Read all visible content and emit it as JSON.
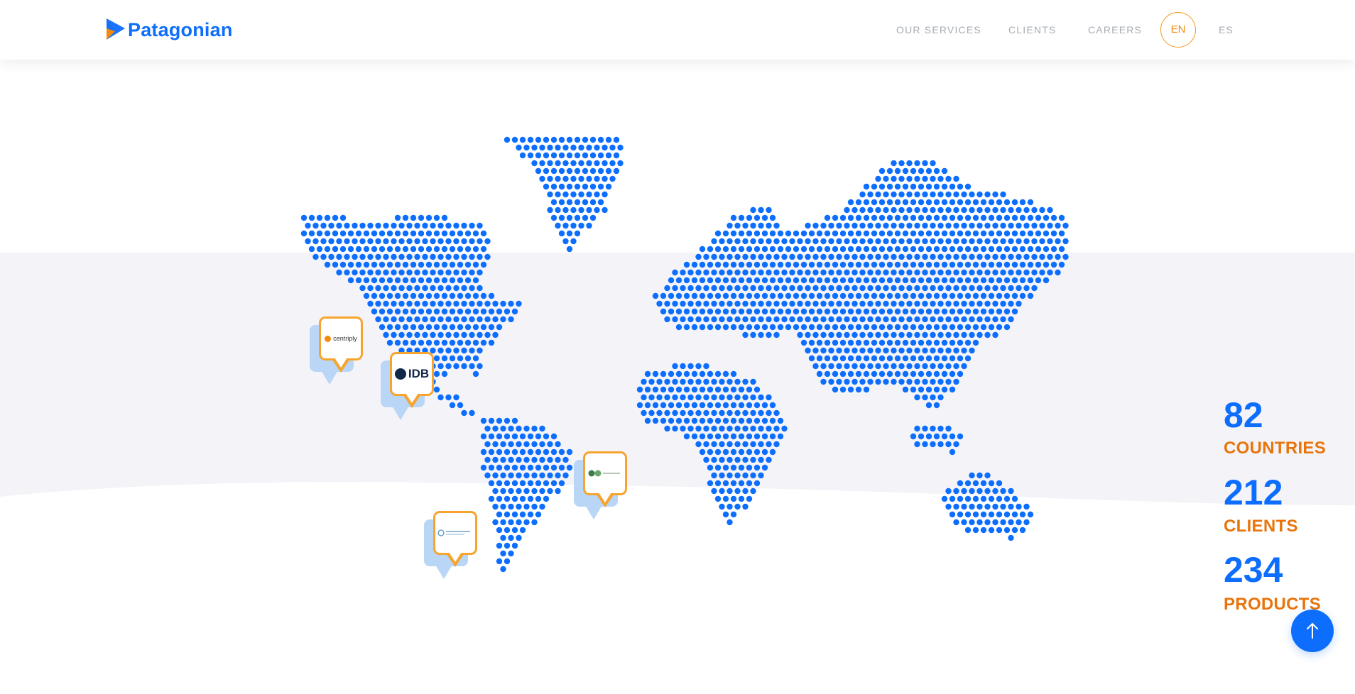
{
  "header": {
    "brand": "Patagonian",
    "nav": [
      {
        "label": "OUR SERVICES"
      },
      {
        "label": "CLIENTS"
      },
      {
        "label": "CAREERS"
      }
    ],
    "lang_active": "EN",
    "lang_other": "ES"
  },
  "stats": [
    {
      "value": "82",
      "label": "COUNTRIES"
    },
    {
      "value": "212",
      "label": "CLIENTS"
    },
    {
      "value": "234",
      "label": "PRODUCTS"
    }
  ],
  "pins": [
    {
      "name": "centriply",
      "text": "centriply"
    },
    {
      "name": "idb",
      "text": "IDB"
    },
    {
      "name": "south-america-client",
      "text": ""
    },
    {
      "name": "africa-client",
      "text": ""
    }
  ],
  "colors": {
    "brand_blue": "#0d6efd",
    "accent_orange": "#e8740c",
    "band_gray": "#f4f4f8",
    "pin_border": "#f7a42e"
  },
  "icons": {
    "scroll_top": "arrow-up-icon",
    "logo": "play-flag-icon"
  }
}
